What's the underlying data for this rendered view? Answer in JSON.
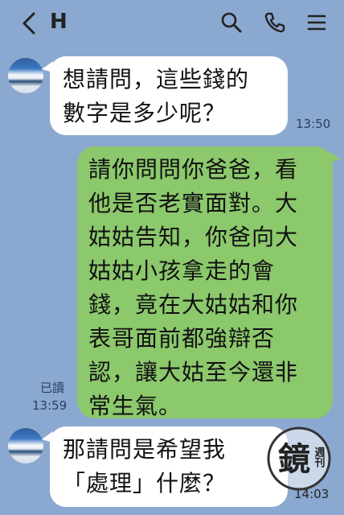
{
  "header": {
    "title": "H",
    "back_icon": "chevron-left-icon",
    "search_icon": "search-icon",
    "call_icon": "phone-icon",
    "menu_icon": "menu-icon"
  },
  "messages": [
    {
      "direction": "incoming",
      "lines": [
        "想請問，這些錢的",
        "數字是多少呢？"
      ],
      "time": "13:50"
    },
    {
      "direction": "outgoing",
      "lines": [
        "請你問問你爸爸，看",
        "他是否老實面對。大",
        "姑姑告知，你爸向大",
        "姑姑小孩拿走的會",
        "錢，竟在大姑姑和你",
        "表哥面前都強辯否",
        "認，讓大姑至今還非",
        "常生氣。"
      ],
      "read_label": "已讀",
      "time": "13:59"
    },
    {
      "direction": "incoming",
      "lines": [
        "那請問是希望我",
        "「處理」什麼？"
      ],
      "time": "14:03"
    }
  ],
  "watermark": {
    "main_char": "鏡",
    "side_chars": "週刊"
  },
  "colors": {
    "background": "#8ba8d0",
    "incoming_bubble": "#ffffff",
    "outgoing_bubble": "#8cc86c"
  }
}
